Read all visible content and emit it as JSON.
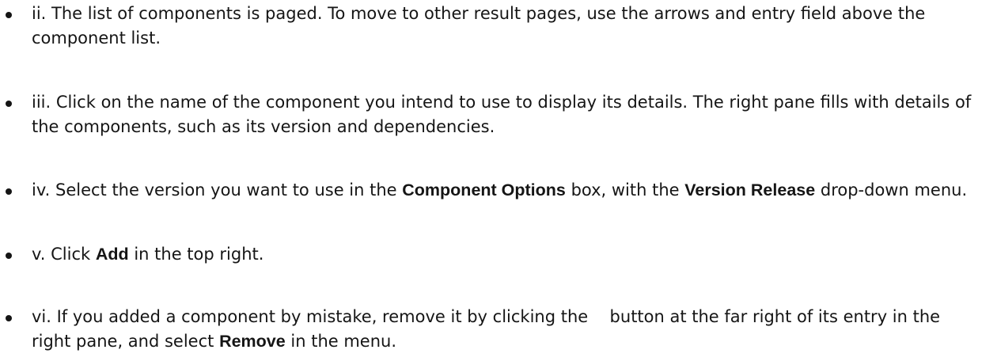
{
  "steps": [
    {
      "text": "ii. The list of components is paged. To move to other result pages, use the arrows and entry field above the component list."
    },
    {
      "text": "iii. Click on the name of the component you intend to use to display its details. The right pane fills with details of the components, such as its version and dependencies."
    },
    {
      "before": "iv. Select the version you want to use in the ",
      "bold1": "Component Options",
      "middle": " box, with the ",
      "bold2": "Version Release",
      "after": " drop-down menu."
    },
    {
      "before": "v. Click ",
      "bold1": "Add",
      "after": " in the top right."
    },
    {
      "before": "vi. If you added a component by mistake, remove it by clicking the ",
      "after_icon": " button at the far right of its entry in the right pane, and select ",
      "bold1": "Remove",
      "after": " in the menu."
    }
  ]
}
